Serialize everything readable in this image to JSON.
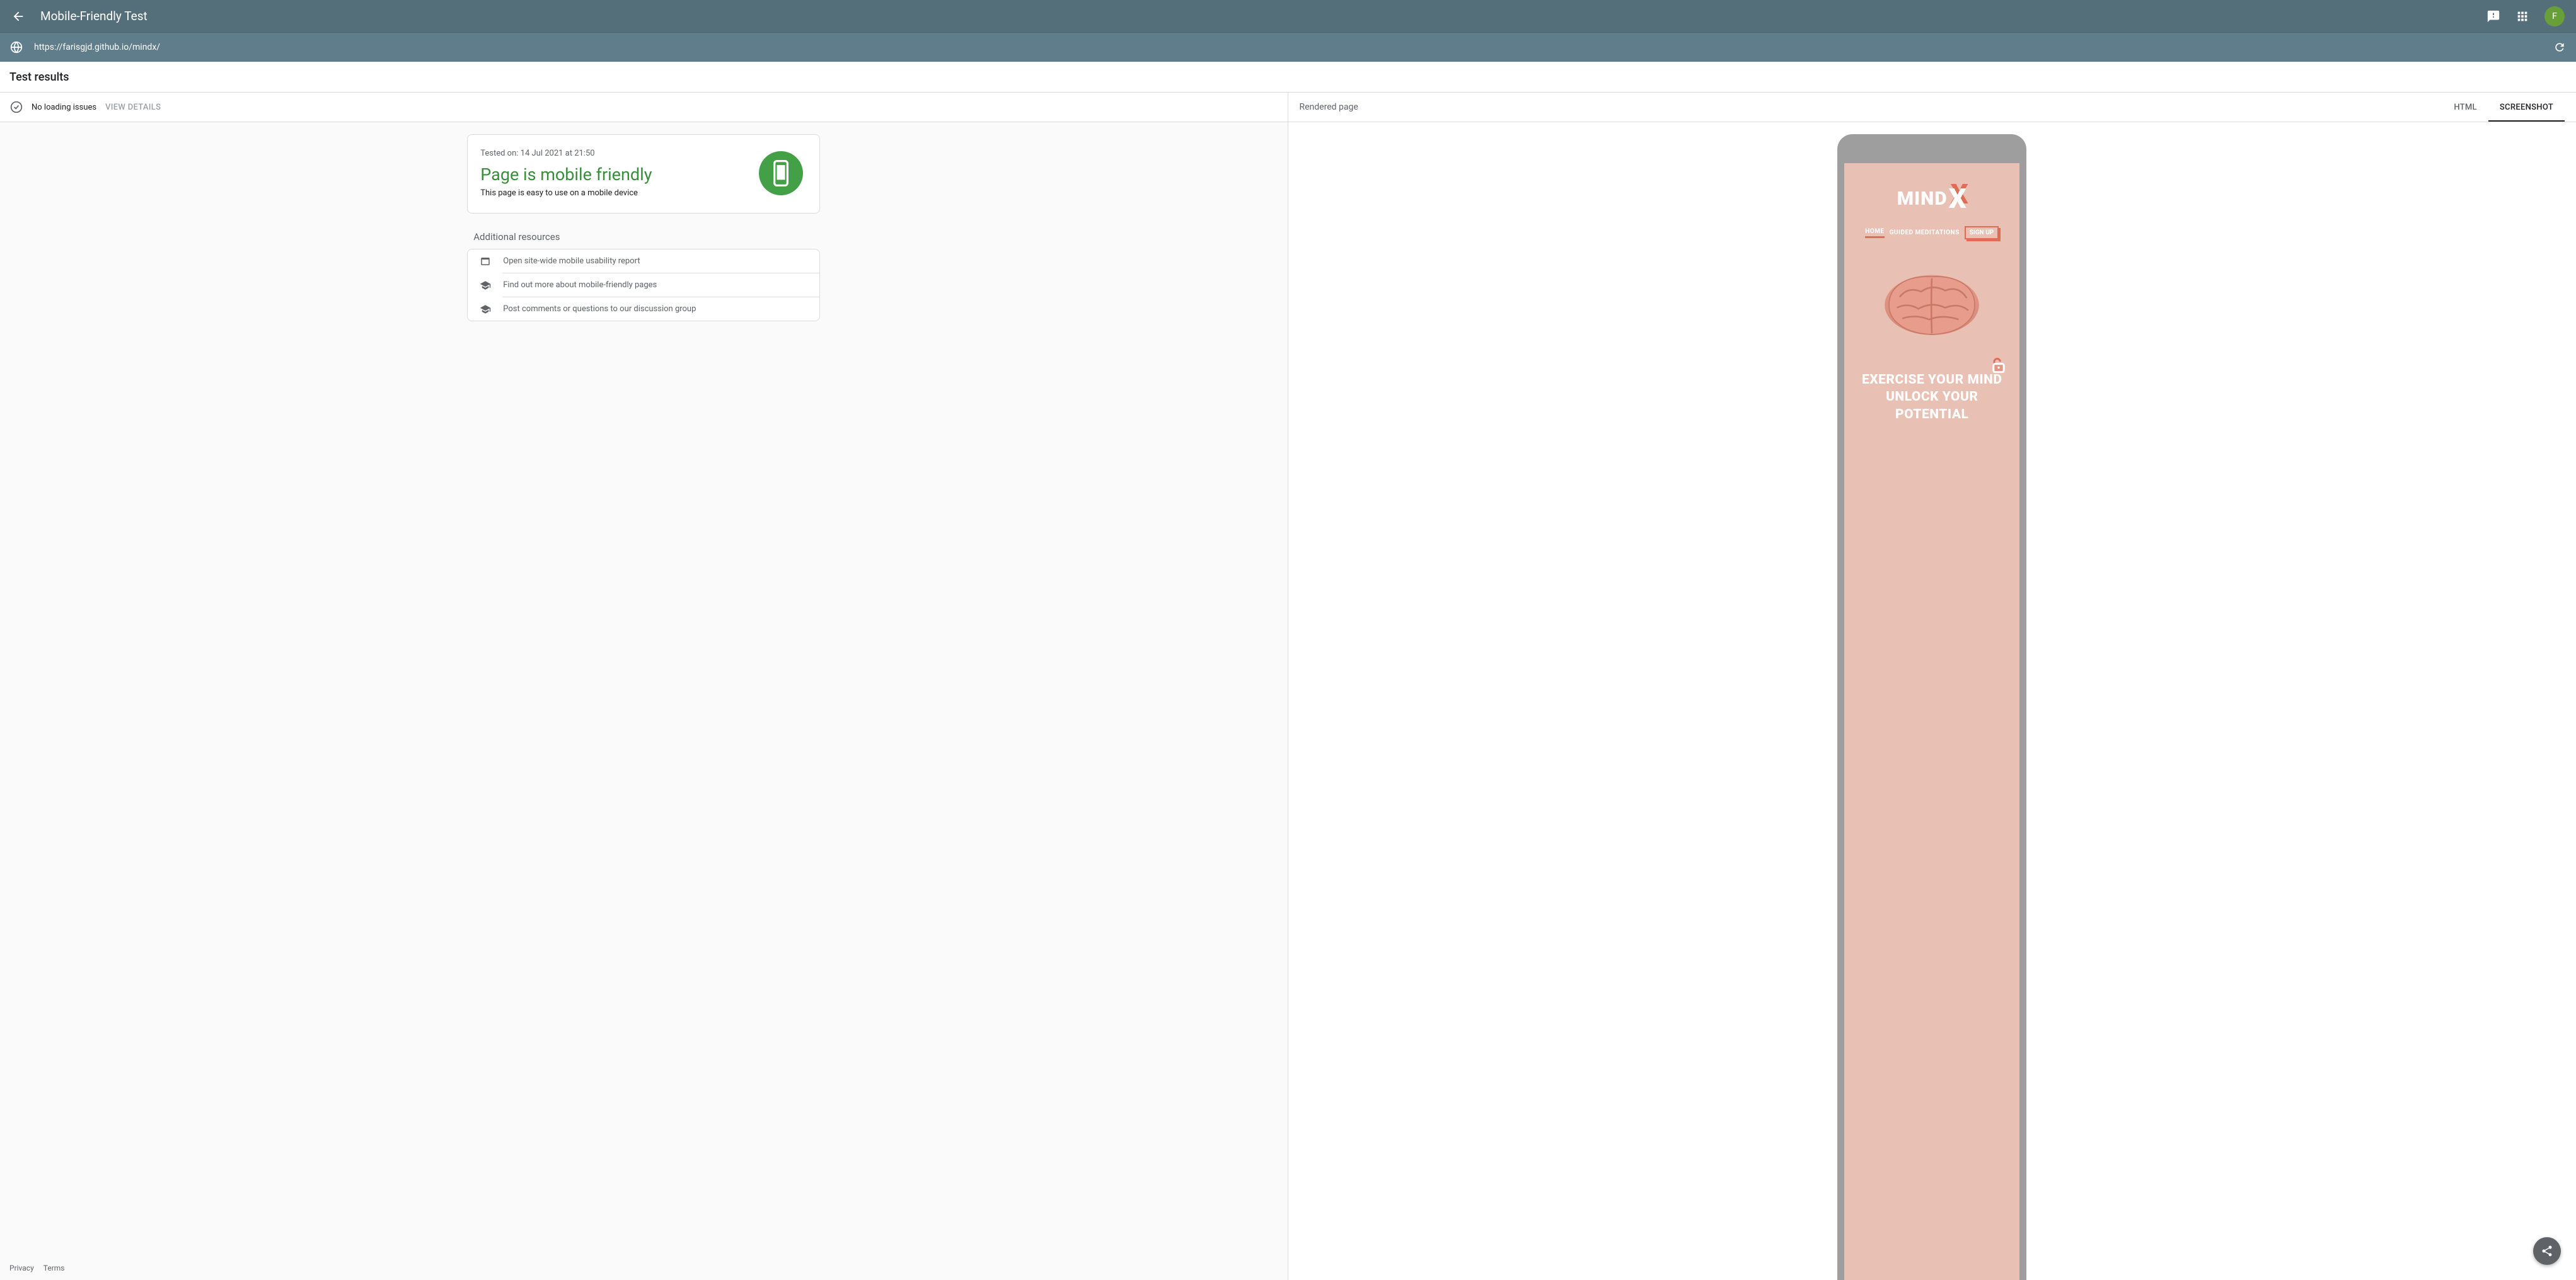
{
  "header": {
    "title": "Mobile-Friendly Test",
    "avatar_letter": "F"
  },
  "url_bar": {
    "url": "https://farisgjd.github.io/mindx/"
  },
  "results_header": "Test results",
  "status": {
    "text": "No loading issues",
    "view_details": "VIEW DETAILS"
  },
  "result_card": {
    "tested_on": "Tested on: 14 Jul 2021 at 21:50",
    "verdict": "Page is mobile friendly",
    "sub": "This page is easy to use on a mobile device"
  },
  "additional_heading": "Additional resources",
  "resources": [
    "Open site-wide mobile usability report",
    "Find out more about mobile-friendly pages",
    "Post comments or questions to our discussion group"
  ],
  "footer": {
    "privacy": "Privacy",
    "terms": "Terms"
  },
  "right": {
    "rendered_label": "Rendered page",
    "tabs": {
      "html": "HTML",
      "screenshot": "SCREENSHOT"
    }
  },
  "preview": {
    "logo_text": "MIND",
    "logo_x": "X",
    "nav": {
      "home": "HOME",
      "guided": "GUIDED MEDITATIONS",
      "signup": "SIGN UP"
    },
    "tagline_line1": "EXERCISE YOUR MIND",
    "tagline_line2": "UNLOCK YOUR",
    "tagline_line3": "POTENTIAL"
  }
}
